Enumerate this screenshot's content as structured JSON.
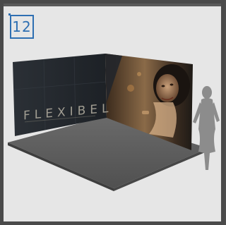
{
  "badge": {
    "number": "12"
  },
  "booth": {
    "brand_text": "FLEXIBEL"
  },
  "colors": {
    "frame": "#4a4a4a",
    "background": "#e6e6e6",
    "badge_accent": "#2e6fb2",
    "floor": "#5f5f5f",
    "wall_dark": "#23272c",
    "silhouette": "#8a8a8a"
  }
}
